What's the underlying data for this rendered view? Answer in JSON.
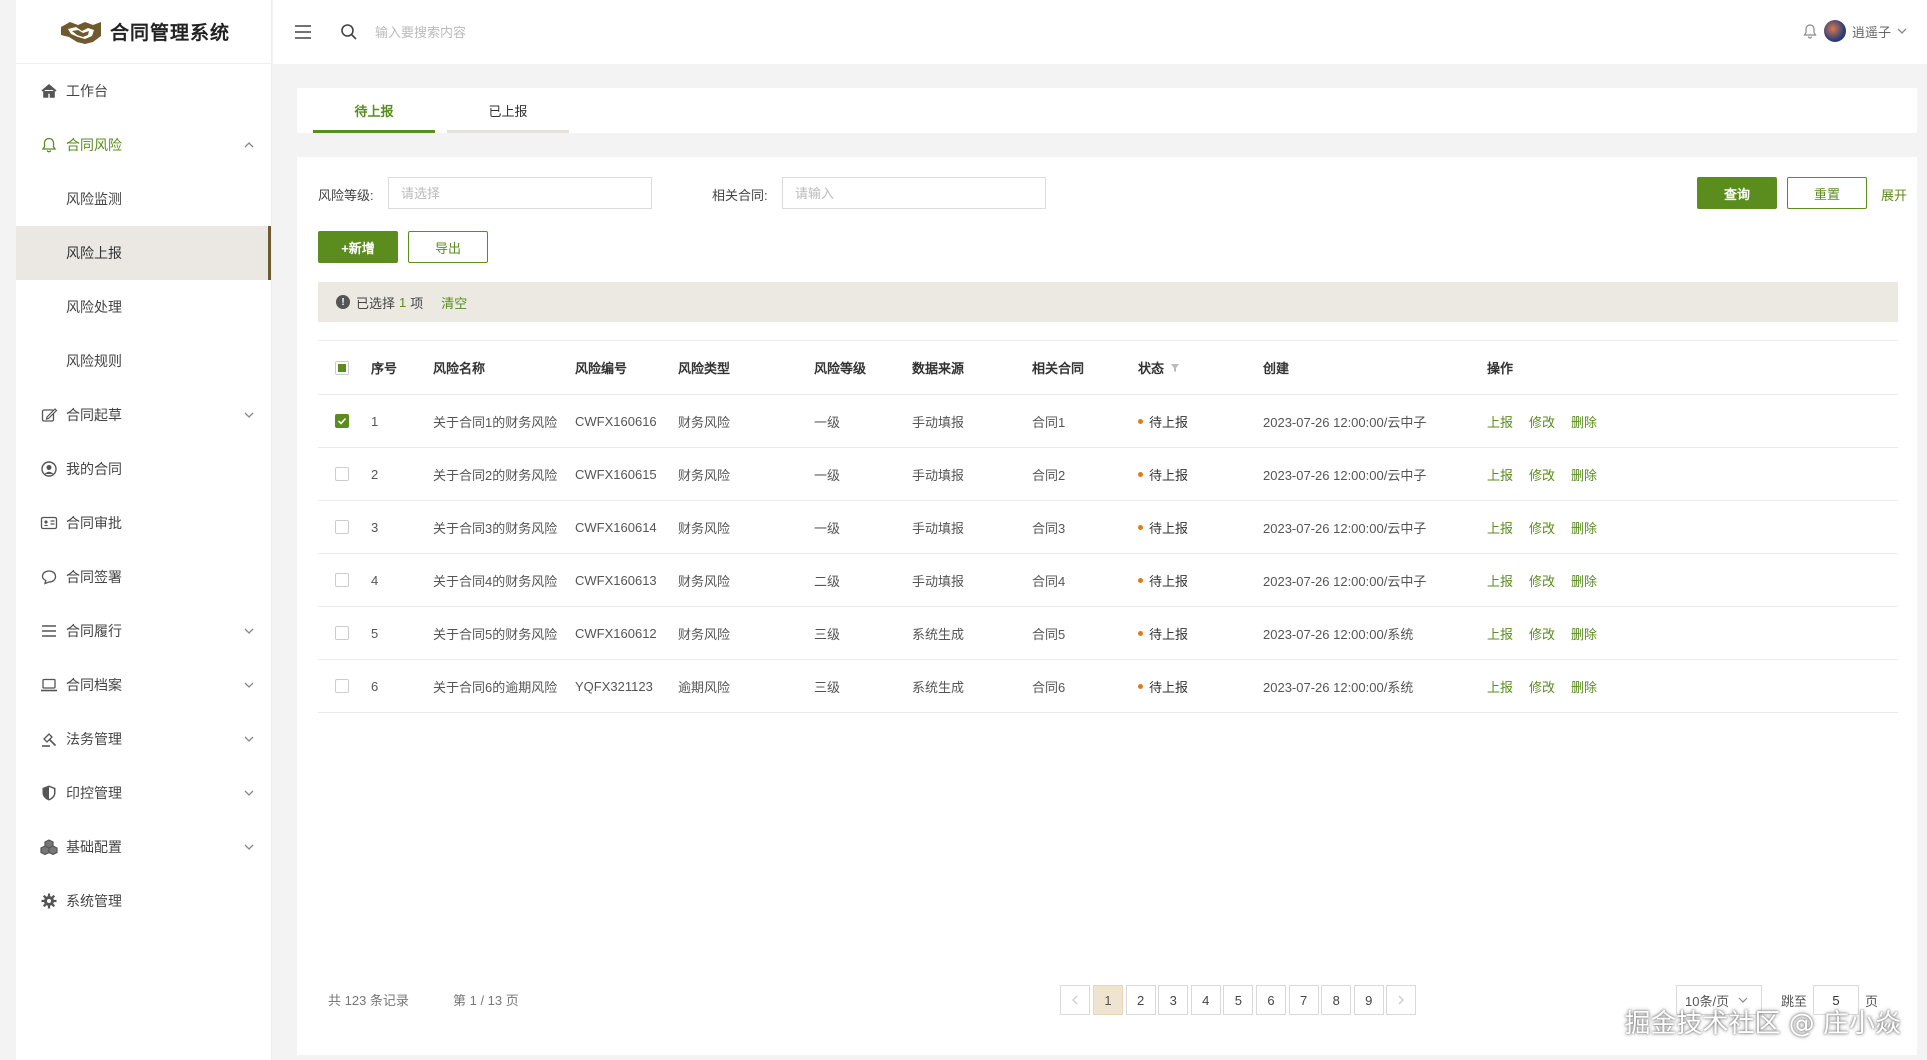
{
  "app": {
    "title": "合同管理系统"
  },
  "sidebar": {
    "items": [
      {
        "label": "工作台",
        "icon": "home-icon"
      },
      {
        "label": "合同风险",
        "icon": "bell-icon",
        "expanded": true,
        "children": [
          {
            "label": "风险监测"
          },
          {
            "label": "风险上报",
            "active": true
          },
          {
            "label": "风险处理"
          },
          {
            "label": "风险规则"
          }
        ]
      },
      {
        "label": "合同起草",
        "icon": "edit-icon",
        "has_children": true
      },
      {
        "label": "我的合同",
        "icon": "user-circle-icon"
      },
      {
        "label": "合同审批",
        "icon": "id-card-icon"
      },
      {
        "label": "合同签署",
        "icon": "chat-icon"
      },
      {
        "label": "合同履行",
        "icon": "list-icon",
        "has_children": true
      },
      {
        "label": "合同档案",
        "icon": "laptop-icon",
        "has_children": true
      },
      {
        "label": "法务管理",
        "icon": "gavel-icon",
        "has_children": true
      },
      {
        "label": "印控管理",
        "icon": "shield-icon",
        "has_children": true
      },
      {
        "label": "基础配置",
        "icon": "cubes-icon",
        "has_children": true
      },
      {
        "label": "系统管理",
        "icon": "gear-icon"
      }
    ]
  },
  "topbar": {
    "search_placeholder": "输入要搜索内容",
    "user_name": "逍遥子"
  },
  "tabs": [
    {
      "label": "待上报",
      "active": true
    },
    {
      "label": "已上报",
      "active": false
    }
  ],
  "filters": {
    "risk_level_label": "风险等级:",
    "risk_level_placeholder": "请选择",
    "contract_label": "相关合同:",
    "contract_placeholder": "请输入",
    "query_button": "查询",
    "reset_button": "重置",
    "expand_link": "展开"
  },
  "actions": {
    "add_button": "+新增",
    "export_button": "导出"
  },
  "selection": {
    "prefix": "已选择",
    "count": "1",
    "suffix": "项",
    "clear": "清空"
  },
  "table": {
    "headers": [
      "序号",
      "风险名称",
      "风险编号",
      "风险类型",
      "风险等级",
      "数据来源",
      "相关合同",
      "状态",
      "创建",
      "操作"
    ],
    "rows": [
      {
        "checked": true,
        "index": "1",
        "name": "关于合同1的财务风险",
        "code": "CWFX160616",
        "type": "财务风险",
        "level": "一级",
        "source": "手动填报",
        "contract": "合同1",
        "status": "待上报",
        "created": "2023-07-26 12:00:00/云中子"
      },
      {
        "checked": false,
        "index": "2",
        "name": "关于合同2的财务风险",
        "code": "CWFX160615",
        "type": "财务风险",
        "level": "一级",
        "source": "手动填报",
        "contract": "合同2",
        "status": "待上报",
        "created": "2023-07-26 12:00:00/云中子"
      },
      {
        "checked": false,
        "index": "3",
        "name": "关于合同3的财务风险",
        "code": "CWFX160614",
        "type": "财务风险",
        "level": "一级",
        "source": "手动填报",
        "contract": "合同3",
        "status": "待上报",
        "created": "2023-07-26 12:00:00/云中子"
      },
      {
        "checked": false,
        "index": "4",
        "name": "关于合同4的财务风险",
        "code": "CWFX160613",
        "type": "财务风险",
        "level": "二级",
        "source": "手动填报",
        "contract": "合同4",
        "status": "待上报",
        "created": "2023-07-26 12:00:00/云中子"
      },
      {
        "checked": false,
        "index": "5",
        "name": "关于合同5的财务风险",
        "code": "CWFX160612",
        "type": "财务风险",
        "level": "三级",
        "source": "系统生成",
        "contract": "合同5",
        "status": "待上报",
        "created": "2023-07-26 12:00:00/系统"
      },
      {
        "checked": false,
        "index": "6",
        "name": "关于合同6的逾期风险",
        "code": "YQFX321123",
        "type": "逾期风险",
        "level": "三级",
        "source": "系统生成",
        "contract": "合同6",
        "status": "待上报",
        "created": "2023-07-26 12:00:00/系统"
      }
    ],
    "row_actions": [
      "上报",
      "修改",
      "删除"
    ]
  },
  "pagination": {
    "total_text": "共 123 条记录",
    "page_text": "第 1 / 13 页",
    "pages": [
      "1",
      "2",
      "3",
      "4",
      "5",
      "6",
      "7",
      "8",
      "9"
    ],
    "current_page": "1",
    "page_size": "10条/页",
    "jump_label": "跳至",
    "jump_value": "5",
    "jump_suffix": "页"
  },
  "watermark": "掘金技术社区 @ 庄小焱",
  "colors": {
    "accent": "#5a8c1e",
    "status_dot": "#e07b1a",
    "active_page_bg": "#efe4cf",
    "selection_bar": "#ece9e3"
  }
}
